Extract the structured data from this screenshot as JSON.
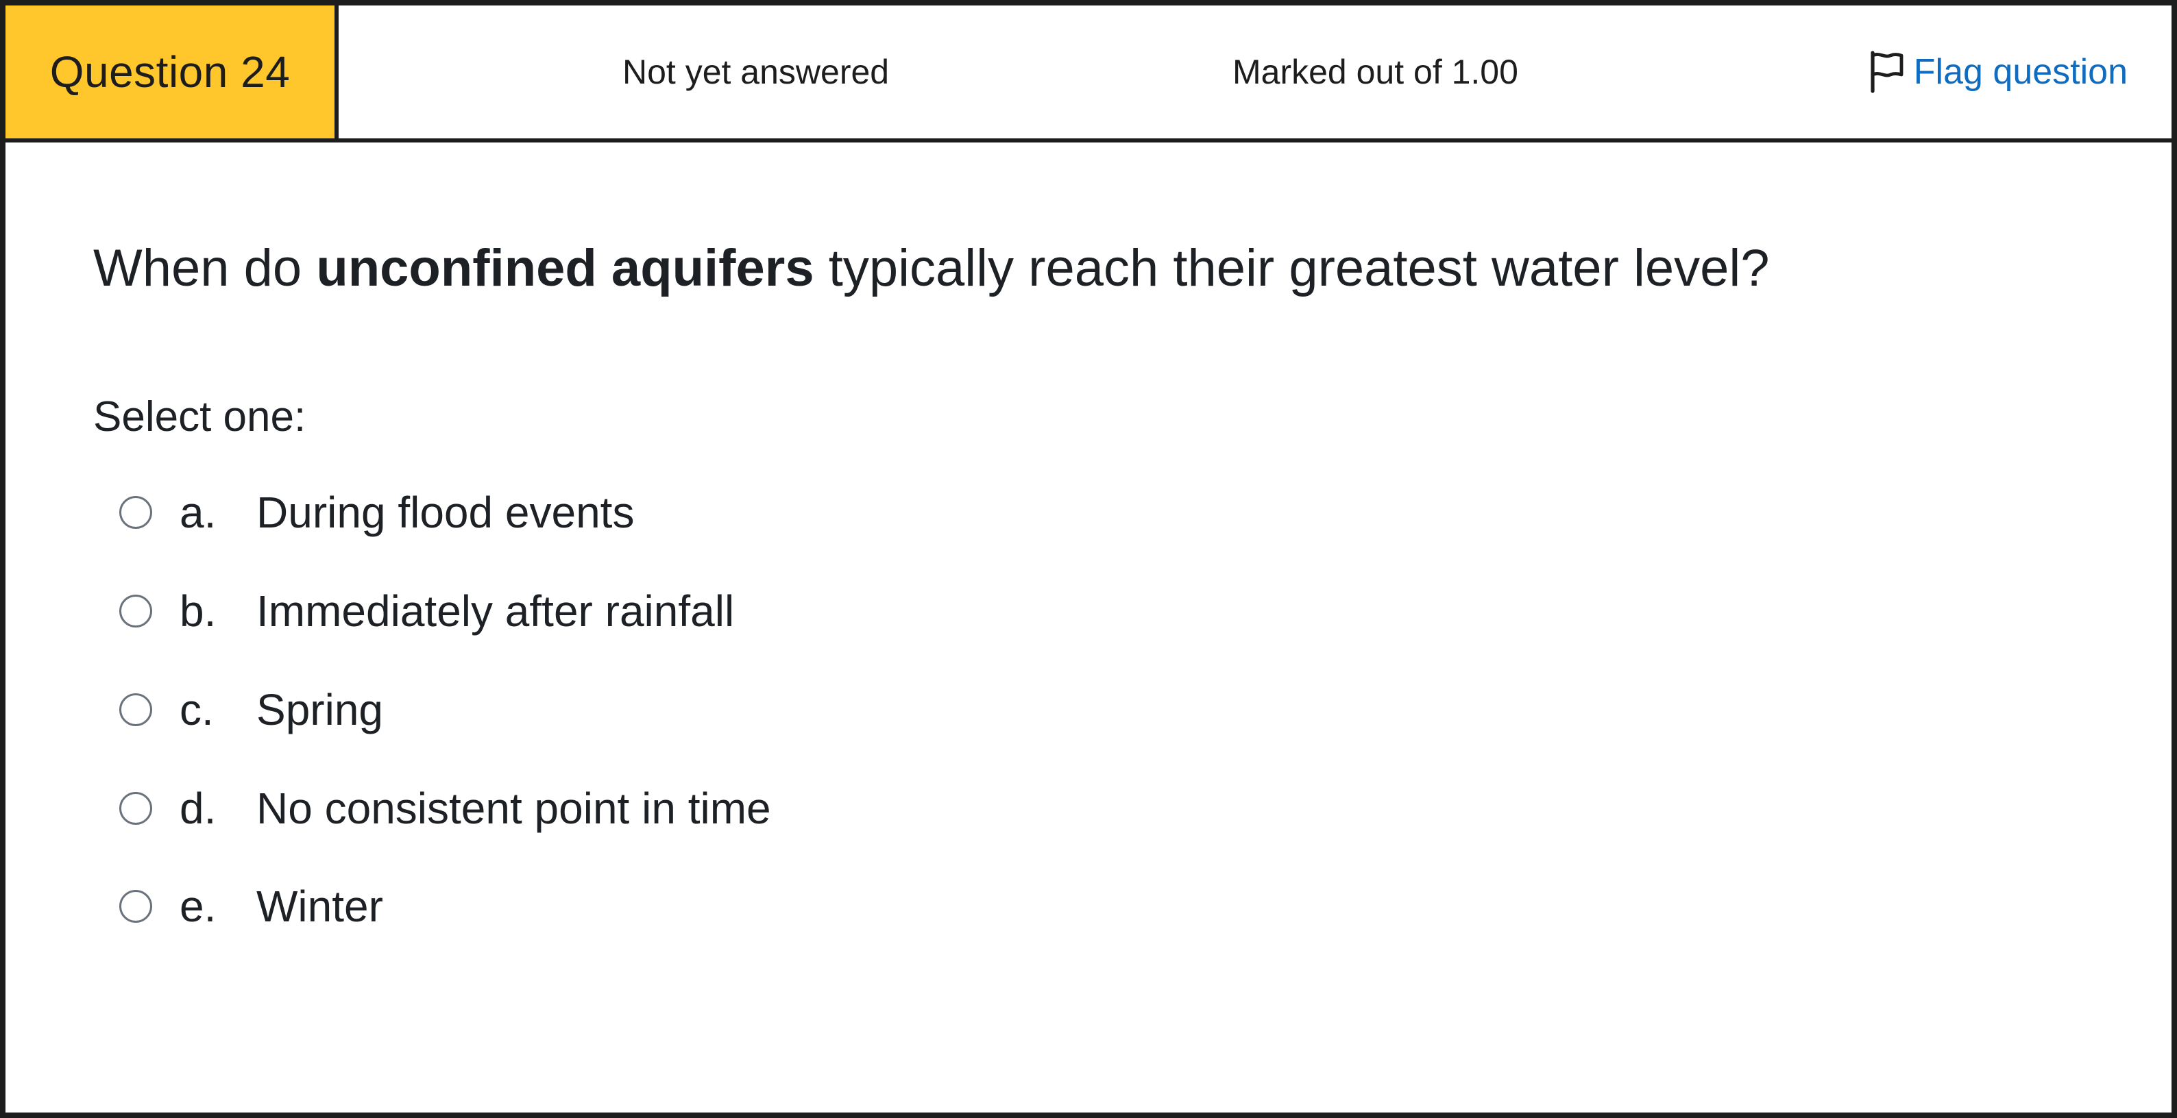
{
  "header": {
    "question_label": "Question 24",
    "state": "Not yet answered",
    "grade": "Marked out of 1.00",
    "flag_label": "Flag question"
  },
  "question": {
    "text_before": "When do ",
    "text_bold": "unconfined aquifers",
    "text_after": " typically reach their greatest water level?",
    "prompt": "Select one:"
  },
  "options": [
    {
      "letter": "a.",
      "label": "During flood events"
    },
    {
      "letter": "b.",
      "label": "Immediately after rainfall"
    },
    {
      "letter": "c.",
      "label": "Spring"
    },
    {
      "letter": "d.",
      "label": "No consistent point in time"
    },
    {
      "letter": "e.",
      "label": "Winter"
    }
  ],
  "colors": {
    "accent": "#ffc72c",
    "link": "#0f6cbf",
    "border": "#1d1d1d"
  }
}
